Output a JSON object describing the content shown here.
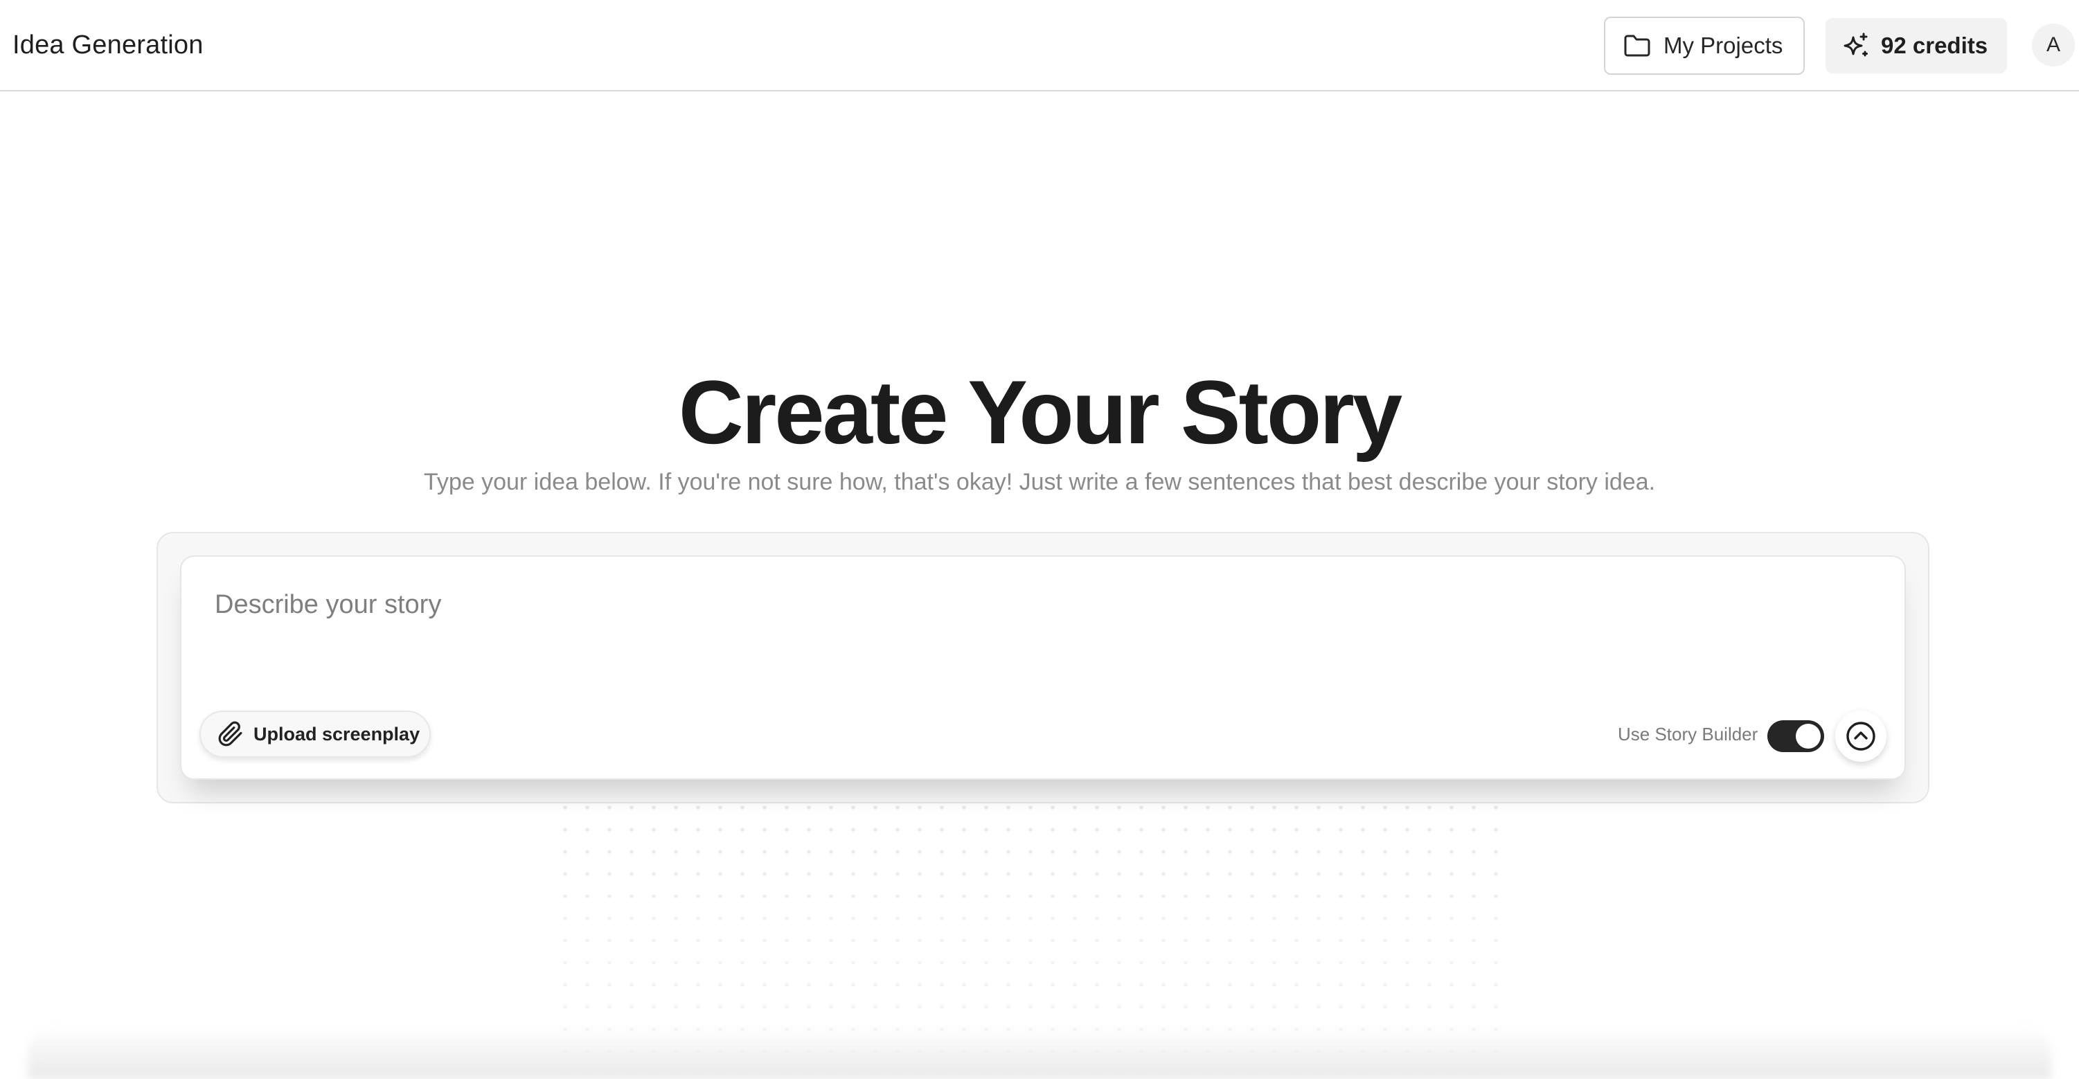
{
  "header": {
    "title": "Idea Generation",
    "projects_label": "My Projects",
    "credits_label": "92 credits",
    "avatar_initial": "A",
    "icons": {
      "projects": "folder-icon",
      "credits": "sparkles-icon"
    }
  },
  "hero": {
    "title": "Create Your Story",
    "subtitle": "Type your idea below. If you're not sure how, that's okay! Just write a few sentences that best describe your story idea."
  },
  "composer": {
    "input_value": "",
    "input_placeholder": "Describe your story",
    "upload_label": "Upload screenplay",
    "upload_icon": "paperclip-icon",
    "builder_label": "Use Story Builder",
    "builder_enabled": true,
    "submit_icon": "chevron-up-circle-icon"
  },
  "colors": {
    "text_primary": "#1f1f1f",
    "text_muted": "#8a8a8a",
    "toggle_on": "#262626",
    "border": "#d9d9d9"
  }
}
